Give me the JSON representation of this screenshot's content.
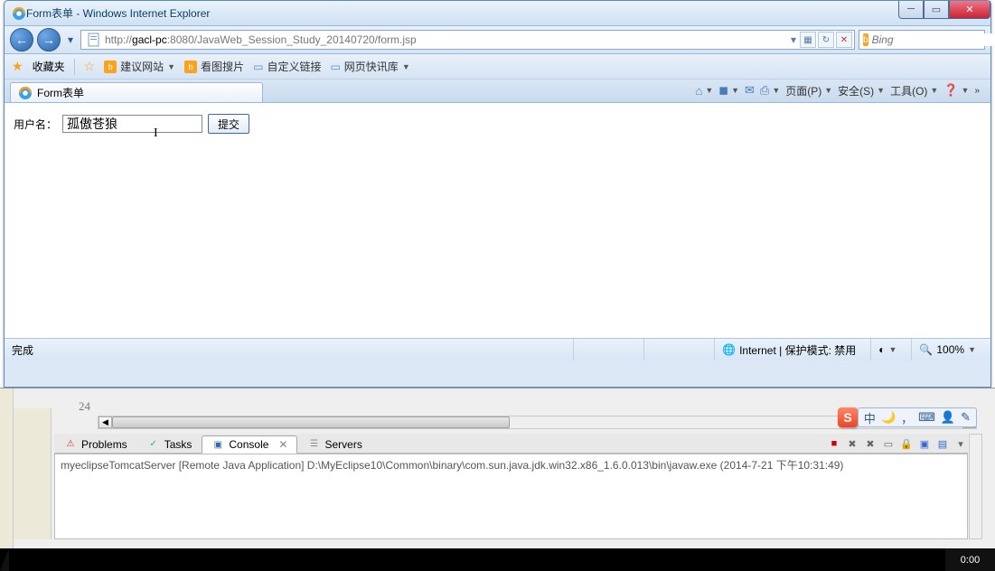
{
  "window": {
    "title": "Form表单 - Windows Internet Explorer"
  },
  "nav": {
    "url_prefix": "http://",
    "url_host": "gacl-pc",
    "url_port": ":8080",
    "url_path": "/JavaWeb_Session_Study_20140720/form.jsp",
    "search_placeholder": "Bing"
  },
  "favorites": {
    "label": "收藏夹",
    "suggest": "建议网站",
    "image_search": "看图搜片",
    "custom_links": "自定义链接",
    "news": "网页快讯库"
  },
  "tab": {
    "title": "Form表单"
  },
  "commands": {
    "page": "页面(P)",
    "safety": "安全(S)",
    "tools": "工具(O)"
  },
  "form": {
    "username_label": "用户名：",
    "username_value": "孤傲苍狼",
    "submit_label": "提交"
  },
  "status": {
    "done": "完成",
    "zone": "Internet | 保护模式: 禁用",
    "zoom": "100%"
  },
  "editor": {
    "line_number": "24"
  },
  "ide_tabs": {
    "problems": "Problems",
    "tasks": "Tasks",
    "console": "Console",
    "servers": "Servers"
  },
  "console": {
    "text": "myeclipseTomcatServer [Remote Java Application] D:\\MyEclipse10\\Common\\binary\\com.sun.java.jdk.win32.x86_1.6.0.013\\bin\\javaw.exe (2014-7-21 下午10:31:49)"
  },
  "ime": {
    "badge": "S",
    "cn": "中"
  },
  "taskbar": {
    "time": "0:00"
  }
}
